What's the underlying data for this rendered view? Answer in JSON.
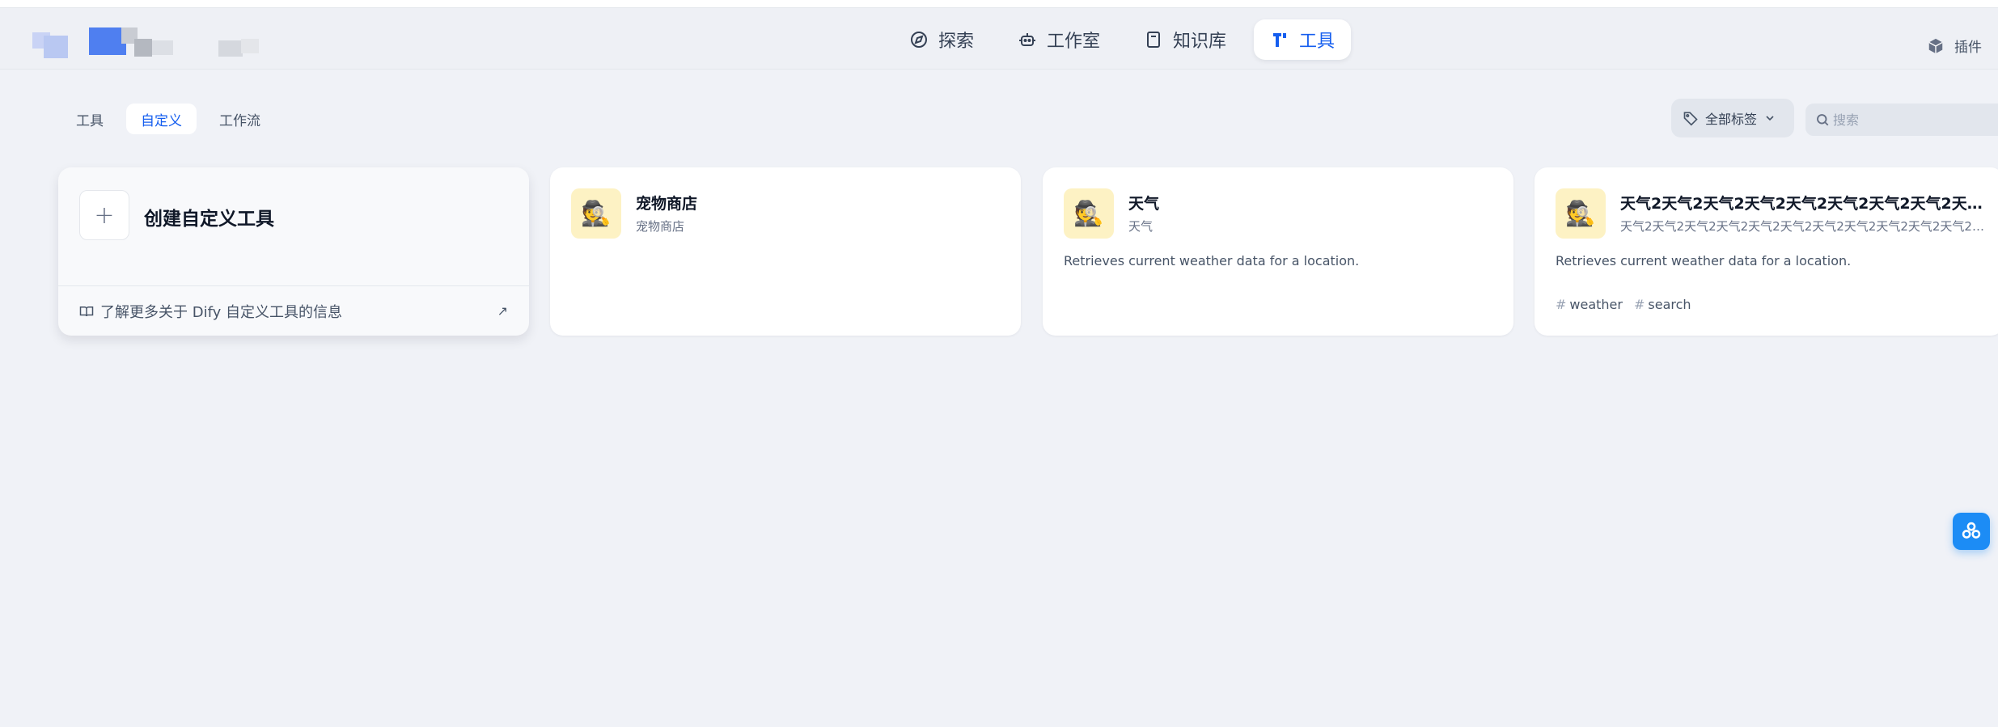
{
  "nav": {
    "items": [
      {
        "label": "探索",
        "icon": "compass-icon"
      },
      {
        "label": "工作室",
        "icon": "robot-icon"
      },
      {
        "label": "知识库",
        "icon": "book-icon"
      },
      {
        "label": "工具",
        "icon": "tools-icon",
        "active": true
      }
    ],
    "plugins_label": "插件"
  },
  "tabs": [
    {
      "label": "工具"
    },
    {
      "label": "自定义",
      "active": true
    },
    {
      "label": "工作流"
    }
  ],
  "filter": {
    "tag_label": "全部标签",
    "search_placeholder": "搜索"
  },
  "create_card": {
    "title": "创建自定义工具",
    "learn_more": "了解更多关于 Dify 自定义工具的信息"
  },
  "tools": [
    {
      "name": "宠物商店",
      "subtitle": "宠物商店",
      "description": "",
      "tags": []
    },
    {
      "name": "天气",
      "subtitle": "天气",
      "description": "Retrieves current weather data for a location.",
      "tags": []
    },
    {
      "name": "天气2天气2天气2天气2天气2天气2天气2天气2天气2天气2天…",
      "subtitle": "天气2天气2天气2天气2天气2天气2天气2天气2天气2天气2天气2…",
      "description": "Retrieves current weather data for a location.",
      "tags": [
        "weather",
        "search"
      ]
    }
  ],
  "colors": {
    "accent": "#155eef",
    "background": "#f0f2f7",
    "icon_bg": "#fdf2c4"
  }
}
